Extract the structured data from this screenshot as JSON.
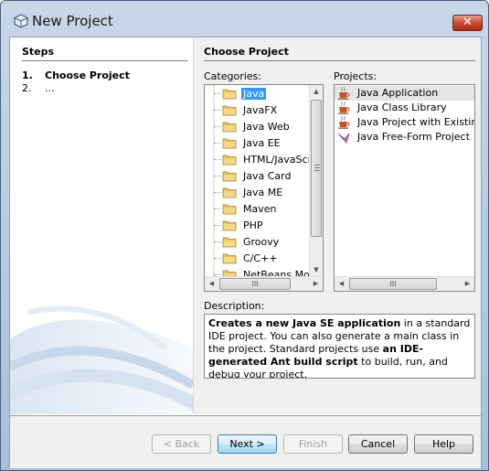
{
  "window": {
    "title": "New Project",
    "close_glyph": "✕"
  },
  "steps": {
    "title": "Steps",
    "items": [
      {
        "num": "1.",
        "label": "Choose Project"
      },
      {
        "num": "2.",
        "label": "..."
      }
    ]
  },
  "main": {
    "title": "Choose Project",
    "categories_label": "Categories:",
    "projects_label": "Projects:",
    "description_label": "Description:",
    "categories": [
      "Java",
      "JavaFX",
      "Java Web",
      "Java EE",
      "HTML/JavaScr",
      "Java Card",
      "Java ME",
      "Maven",
      "PHP",
      "Groovy",
      "C/C++",
      "NetBeans Mod"
    ],
    "selected_category": "Java",
    "projects": [
      "Java Application",
      "Java Class Library",
      "Java Project with Existing S",
      "Java Free-Form Project"
    ],
    "selected_project": "Java Application",
    "description": {
      "part1_bold": "Creates a new Java SE application",
      "part2": " in a standard IDE project. You can also generate a main class in the project. Standard projects use ",
      "part3_bold": "an IDE-generated Ant build script",
      "part4": " to build, run, and debug your project."
    },
    "scroll_thumb_glyph": "III"
  },
  "buttons": {
    "back": "< Back",
    "next": "Next >",
    "finish": "Finish",
    "cancel": "Cancel",
    "help": "Help"
  },
  "colors": {
    "selection": "#3399ff",
    "folder": "#e8c15a",
    "cup": "#c2542a"
  }
}
